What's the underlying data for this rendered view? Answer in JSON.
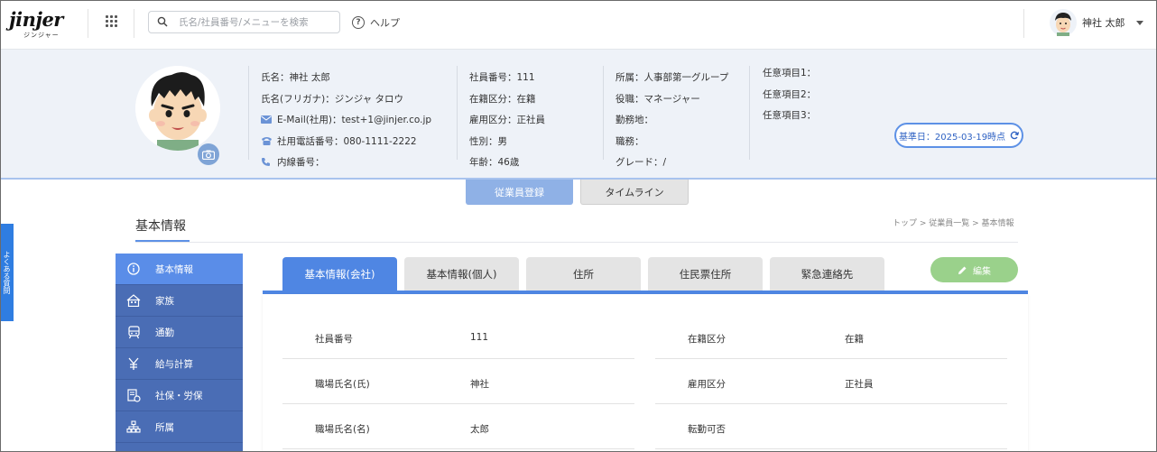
{
  "app": {
    "logo_text": "jinjer",
    "logo_sub": "ジンジャー"
  },
  "header": {
    "search_placeholder": "氏名/社員番号/メニューを検索",
    "help_label": "ヘルプ",
    "user_name": "神社 太郎"
  },
  "profile": {
    "col1": {
      "name": "氏名：神社 太郎",
      "kana": "氏名(フリガナ)：ジンジャ タロウ",
      "email": "E-Mail(社用)：test+1@jinjer.co.jp",
      "phone": "社用電話番号：080-1111-2222",
      "extension": "内線番号："
    },
    "col2": {
      "employee_no": "社員番号：111",
      "status": "在籍区分：在籍",
      "employment_type": "雇用区分：正社員",
      "gender": "性別：男",
      "age": "年齢：46歳"
    },
    "col3": {
      "department": "所属：人事部第一グループ",
      "position": "役職：マネージャー",
      "workplace": "勤務地：",
      "job": "職務：",
      "grade": "グレード：/"
    },
    "col4": {
      "optional1": "任意項目1：",
      "optional2": "任意項目2：",
      "optional3": "任意項目3："
    },
    "base_date": "基準日：2025-03-19時点"
  },
  "main_tabs": {
    "employee_registration": "従業員登録",
    "timeline": "タイムライン"
  },
  "section": {
    "title": "基本情報",
    "breadcrumb": "トップ > 従業員一覧 > 基本情報"
  },
  "side_flag": "よくある質問",
  "menu": {
    "items": [
      {
        "label": "基本情報",
        "icon": "info-icon"
      },
      {
        "label": "家族",
        "icon": "family-house-icon"
      },
      {
        "label": "通勤",
        "icon": "train-icon"
      },
      {
        "label": "給与計算",
        "icon": "yen-icon"
      },
      {
        "label": "社保・労保",
        "icon": "insurance-doc-icon"
      },
      {
        "label": "所属",
        "icon": "org-chart-icon"
      }
    ]
  },
  "content_tabs": [
    "基本情報(会社)",
    "基本情報(個人)",
    "住所",
    "住民票住所",
    "緊急連絡先"
  ],
  "edit_label": "編集",
  "fields": {
    "left": [
      {
        "label": "社員番号",
        "value": "111"
      },
      {
        "label": "職場氏名(氏)",
        "value": "神社"
      },
      {
        "label": "職場氏名(名)",
        "value": "太郎"
      }
    ],
    "right": [
      {
        "label": "在籍区分",
        "value": "在籍"
      },
      {
        "label": "雇用区分",
        "value": "正社員"
      },
      {
        "label": "転勤可否",
        "value": ""
      }
    ]
  },
  "colors": {
    "accent": "#4f86e3",
    "menu_bg": "#4a6db5",
    "menu_active": "#5a8de8",
    "edit_button": "#9ad18b",
    "profile_bg": "#eef2f8"
  }
}
